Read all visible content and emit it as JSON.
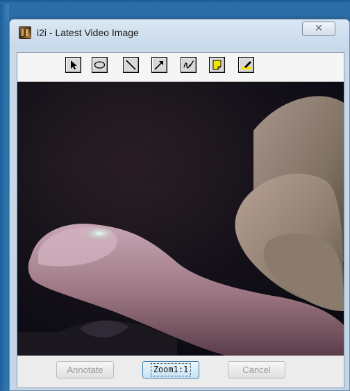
{
  "window": {
    "title": "i2i - Latest Video Image",
    "close_symbol": "✕"
  },
  "toolbar": {
    "tools": [
      {
        "name": "select-arrow-icon",
        "tooltip": ""
      },
      {
        "name": "ellipse-icon",
        "tooltip": ""
      },
      {
        "name": "line-icon",
        "tooltip": ""
      },
      {
        "name": "arrow-line-icon",
        "tooltip": ""
      },
      {
        "name": "freehand-pen-icon",
        "tooltip": ""
      },
      {
        "name": "sticky-note-icon",
        "tooltip": ""
      },
      {
        "name": "highlighter-icon",
        "tooltip": ""
      }
    ]
  },
  "video": {
    "content": "fingers"
  },
  "buttons": {
    "annotate": "Annotate",
    "zoom": "Zoom1:1",
    "cancel": "Cancel"
  },
  "colors": {
    "desktop": "#2a6fa8",
    "window_frame": "#c8d9ea",
    "toolbar_bg": "#f5f5f5",
    "sticky_yellow": "#f5e400",
    "focus_blue": "#3c7fb1"
  }
}
